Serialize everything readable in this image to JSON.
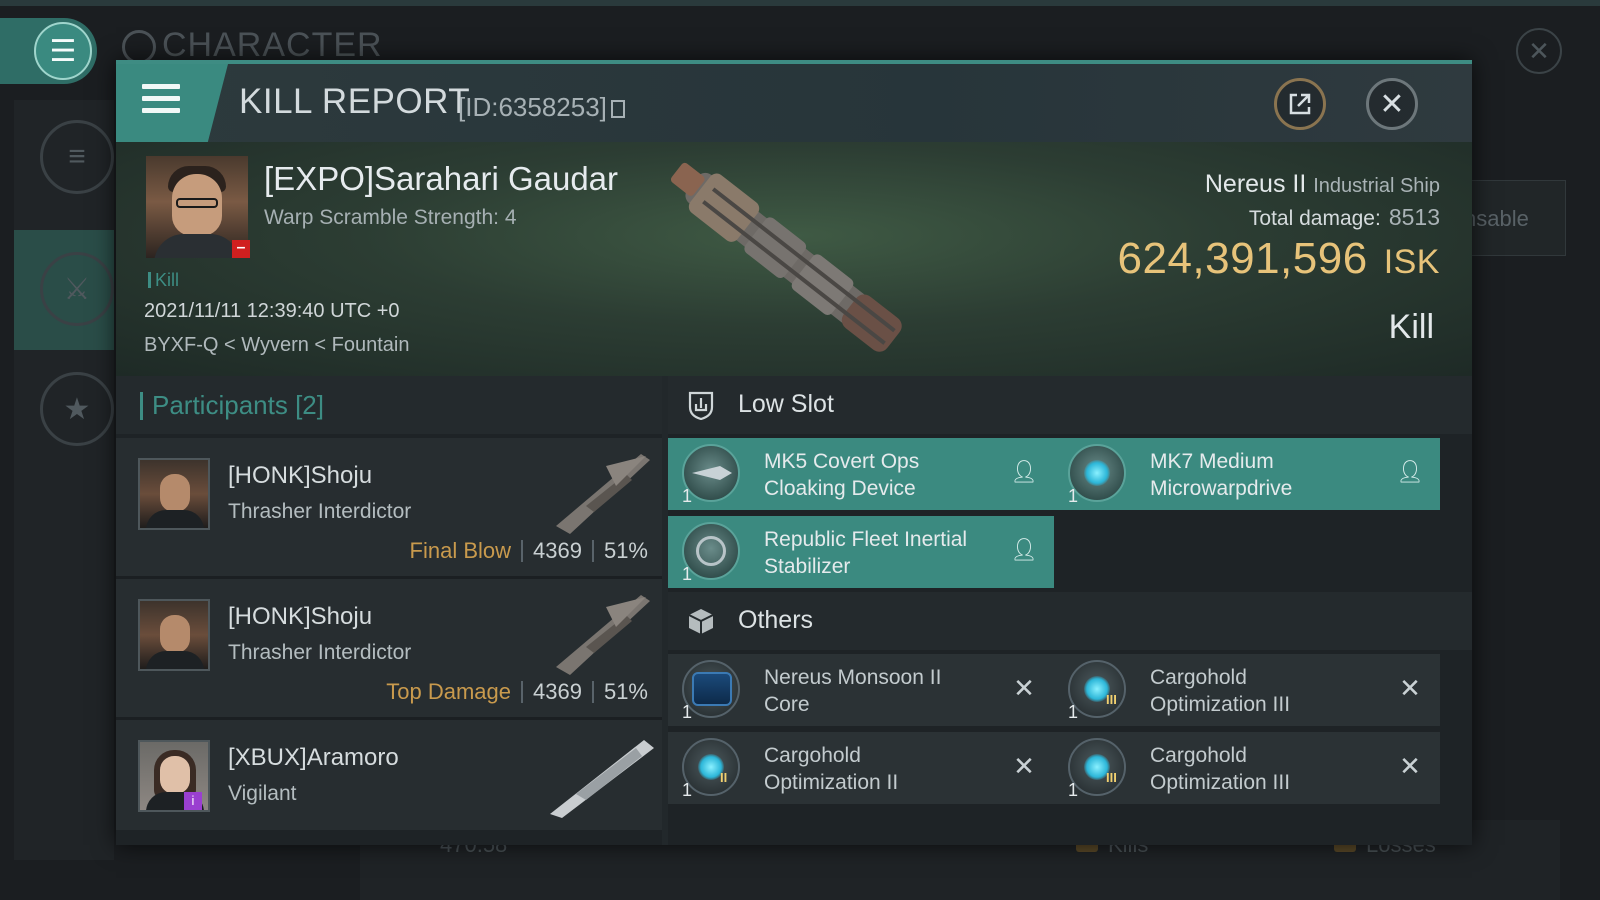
{
  "background": {
    "title": "CHARACTER",
    "right_text": "nsable",
    "bottom_value": "470.58",
    "bottom_kills": "Kills",
    "bottom_losses": "Losses"
  },
  "header": {
    "title": "KILL REPORT",
    "report_id": "[ID:6358253]"
  },
  "victim": {
    "name": "[EXPO]Sarahari Gaudar",
    "warp_scramble": "Warp Scramble Strength: 4",
    "kill_tag": "Kill",
    "datetime": "2021/11/11 12:39:40 UTC +0",
    "location": "BYXF-Q < Wyvern < Fountain",
    "ship_name": "Nereus II",
    "ship_class": "Industrial Ship",
    "total_damage_label": "Total damage:",
    "total_damage": "8513",
    "isk_value": "624,391,596",
    "isk_unit": "ISK",
    "result": "Kill"
  },
  "participants": {
    "title": "Participants [2]",
    "rows": [
      {
        "name": "[HONK]Shoju",
        "ship": "Thrasher Interdictor",
        "tag": "Final Blow",
        "damage": "4369",
        "percent": "51%"
      },
      {
        "name": "[HONK]Shoju",
        "ship": "Thrasher Interdictor",
        "tag": "Top Damage",
        "damage": "4369",
        "percent": "51%"
      },
      {
        "name": "[XBUX]Aramoro",
        "ship": "Vigilant",
        "tag": "",
        "damage": "",
        "percent": ""
      }
    ]
  },
  "fitting": {
    "low_slot_title": "Low Slot",
    "others_title": "Others",
    "low_slot": [
      {
        "name_line1": "MK5 Covert Ops",
        "name_line2": "Cloaking Device",
        "qty": "1",
        "status": "dropped",
        "icon": "cloaking-device-icon"
      },
      {
        "name_line1": "MK7 Medium",
        "name_line2": "Microwarpdrive",
        "qty": "1",
        "status": "dropped",
        "icon": "microwarpdrive-icon"
      },
      {
        "name_line1": "Republic Fleet Inertial",
        "name_line2": "Stabilizer",
        "qty": "1",
        "status": "dropped",
        "icon": "inertial-stabilizer-icon"
      }
    ],
    "others": [
      {
        "name_line1": "Nereus Monsoon II",
        "name_line2": "Core",
        "qty": "1",
        "status": "destroyed",
        "icon": "ship-core-icon"
      },
      {
        "name_line1": "Cargohold",
        "name_line2": "Optimization III",
        "qty": "1",
        "status": "destroyed",
        "icon": "rig-icon",
        "tier": "III"
      },
      {
        "name_line1": "Cargohold",
        "name_line2": "Optimization II",
        "qty": "1",
        "status": "destroyed",
        "icon": "rig-icon",
        "tier": "II"
      },
      {
        "name_line1": "Cargohold",
        "name_line2": "Optimization III",
        "qty": "1",
        "status": "destroyed",
        "icon": "rig-icon",
        "tier": "III"
      }
    ]
  },
  "colors": {
    "accent": "#3d8d84",
    "isk": "#e7c37a",
    "tag": "#c99a4d",
    "dropped_bg": "#3b8a80"
  }
}
